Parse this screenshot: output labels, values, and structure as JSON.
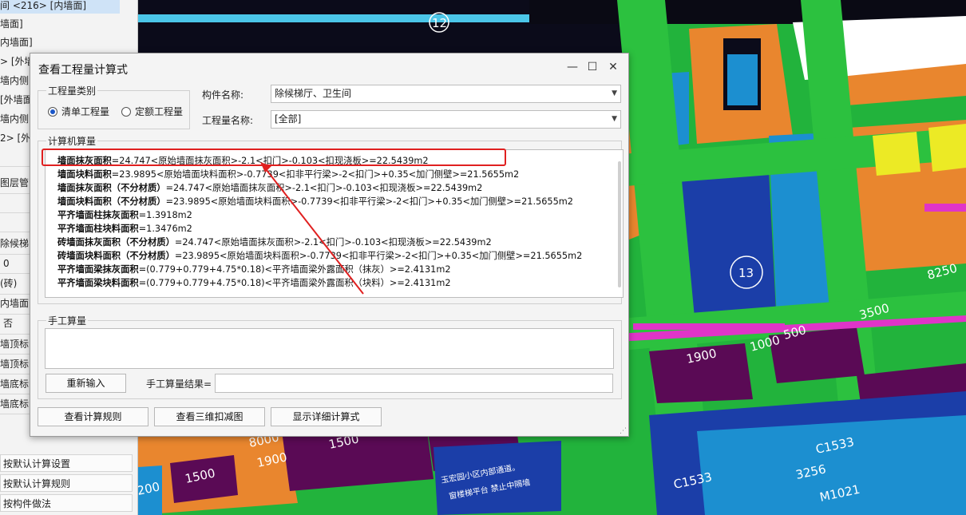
{
  "left_panel": {
    "rows": [
      "间 <216> [内墙面]",
      "墙面]",
      "内墙面]",
      "> [外墙",
      "墙内侧",
      "[外墙面",
      "墙内侧",
      "2> [外",
      "图层管",
      "除候梯",
      "0",
      "(砖)",
      "内墙面",
      "否",
      "墙顶标",
      "墙顶标",
      "墙底标",
      "墙底标"
    ],
    "buttons": [
      "按默认计算设置",
      "按默认计算规则",
      "按构件做法"
    ]
  },
  "viewport": {
    "axis_labels": [
      "12",
      "13"
    ],
    "dimensions": [
      "8250",
      "3500",
      "1900",
      "1000",
      "500",
      "8000",
      "1500",
      "1900",
      "1500",
      "C1533",
      "C1533",
      "3256",
      "M1021",
      "200"
    ],
    "notices": [
      "玉宏园小区内部通道。",
      "窗楼梯平台 禁止中隔墙"
    ]
  },
  "dialog": {
    "title": "查看工程量计算式",
    "controls": {
      "minimize": "—",
      "maximize": "☐",
      "close": "✕"
    },
    "quantity_type": {
      "legend": "工程量类别",
      "options": [
        {
          "label": "清单工程量",
          "selected": true
        },
        {
          "label": "定额工程量",
          "selected": false
        }
      ]
    },
    "component_name": {
      "label": "构件名称:",
      "value": "除候梯厅、卫生间"
    },
    "quantity_name": {
      "label": "工程量名称:",
      "value": "[全部]"
    },
    "computer_calc": {
      "legend": "计算机算量",
      "lines": [
        {
          "name": "墙面抹灰面积",
          "formula": "=24.747<原始墙面抹灰面积>-2.1<扣门>-0.103<扣现浇板>=22.5439m2"
        },
        {
          "name": "墙面块料面积",
          "formula": "=23.9895<原始墙面块料面积>-0.7739<扣非平行梁>-2<扣门>+0.35<加门侧壁>=21.5655m2"
        },
        {
          "name": "墙面抹灰面积（不分材质）",
          "formula": "=24.747<原始墙面抹灰面积>-2.1<扣门>-0.103<扣现浇板>=22.5439m2"
        },
        {
          "name": "墙面块料面积（不分材质）",
          "formula": "=23.9895<原始墙面块料面积>-0.7739<扣非平行梁>-2<扣门>+0.35<加门侧壁>=21.5655m2"
        },
        {
          "name": "平齐墙面柱抹灰面积",
          "formula": "=1.3918m2"
        },
        {
          "name": "平齐墙面柱块料面积",
          "formula": "=1.3476m2"
        },
        {
          "name": "砖墙面抹灰面积（不分材质）",
          "formula": "=24.747<原始墙面抹灰面积>-2.1<扣门>-0.103<扣现浇板>=22.5439m2"
        },
        {
          "name": "砖墙面块料面积（不分材质）",
          "formula": "=23.9895<原始墙面块料面积>-0.7739<扣非平行梁>-2<扣门>+0.35<加门侧壁>=21.5655m2"
        },
        {
          "name": "平齐墙面梁抹灰面积",
          "formula": "=(0.779+0.779+4.75*0.18)<平齐墙面梁外露面积（抹灰）>=2.4131m2"
        },
        {
          "name": "平齐墙面梁块料面积",
          "formula": "=(0.779+0.779+4.75*0.18)<平齐墙面梁外露面积（块料）>=2.4131m2"
        }
      ]
    },
    "manual_calc": {
      "legend": "手工算量",
      "reenter_button": "重新输入",
      "result_label": "手工算量结果="
    },
    "bottom_buttons": [
      "查看计算规则",
      "查看三维扣减图",
      "显示详细计算式"
    ]
  }
}
